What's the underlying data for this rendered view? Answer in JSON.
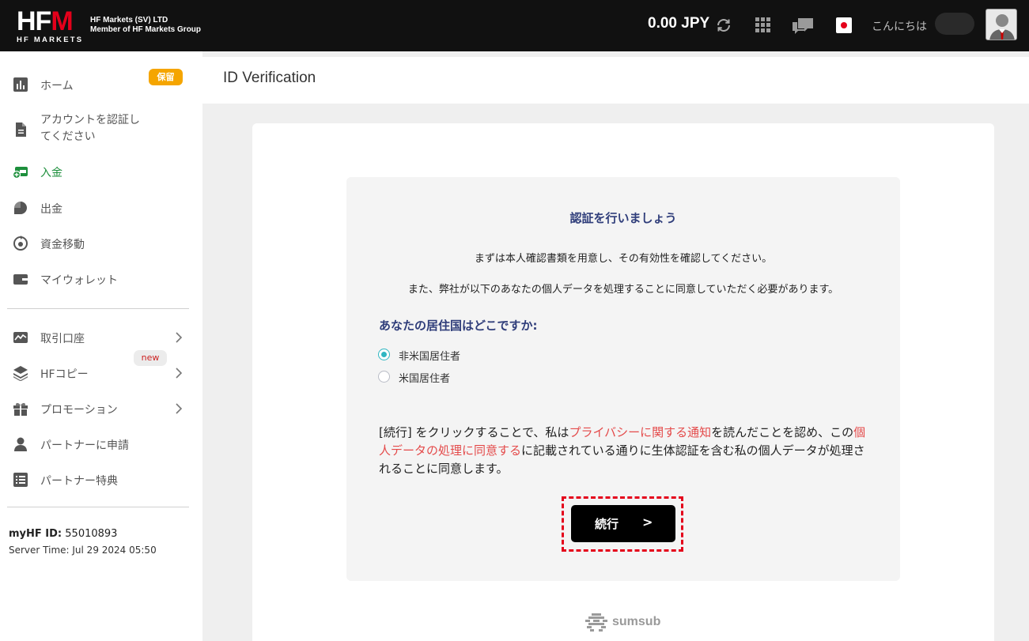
{
  "header": {
    "logo_text": "HFM",
    "logo_subtitle": "HF MARKETS",
    "company_line1": "HF Markets (SV) LTD",
    "company_line2": "Member of HF Markets Group",
    "balance": "0.00 JPY",
    "greeting": "こんにちは"
  },
  "sidebar": {
    "items": [
      {
        "label": "ホーム"
      },
      {
        "label": "アカウントを認証してください",
        "badge": "保留"
      },
      {
        "label": "入金"
      },
      {
        "label": "出金"
      },
      {
        "label": "資金移動"
      },
      {
        "label": "マイウォレット"
      },
      {
        "label": "取引口座"
      },
      {
        "label": "HFコピー"
      },
      {
        "label": "プロモーション",
        "badge": "new"
      },
      {
        "label": "パートナーに申請"
      },
      {
        "label": "パートナー特典"
      }
    ],
    "myhf_label": "myHF ID:",
    "myhf_id": "55010893",
    "server_time": "Server Time: Jul 29 2024 05:50"
  },
  "main": {
    "page_title": "ID Verification",
    "panel_title": "認証を行いましょう",
    "line1": "まずは本人確認書類を用意し、その有効性を確認してください。",
    "line2": "また、弊社が以下のあなたの個人データを処理することに同意していただく必要があります。",
    "question": "あなたの居住国はどこですか:",
    "options": [
      {
        "label": "非米国居住者",
        "selected": true
      },
      {
        "label": "米国居住者",
        "selected": false
      }
    ],
    "consent": {
      "part1": "[続行] をクリックすることで、私は",
      "link1": "プライバシーに関する通知",
      "part2": "を読んだことを認め、この",
      "link2": "個人データの処理に同意する",
      "part3": "に記載されている通りに生体認証を含む私の個人データが処理されることに同意します。"
    },
    "continue_label": "続行",
    "continue_arrow": ">",
    "provider": "sumsub"
  },
  "colors": {
    "accent_red": "#e4001b",
    "active_green": "#1d8f3c",
    "navy": "#2f3d7a",
    "link_red": "#e44a4a",
    "badge_orange": "#f5a500"
  }
}
